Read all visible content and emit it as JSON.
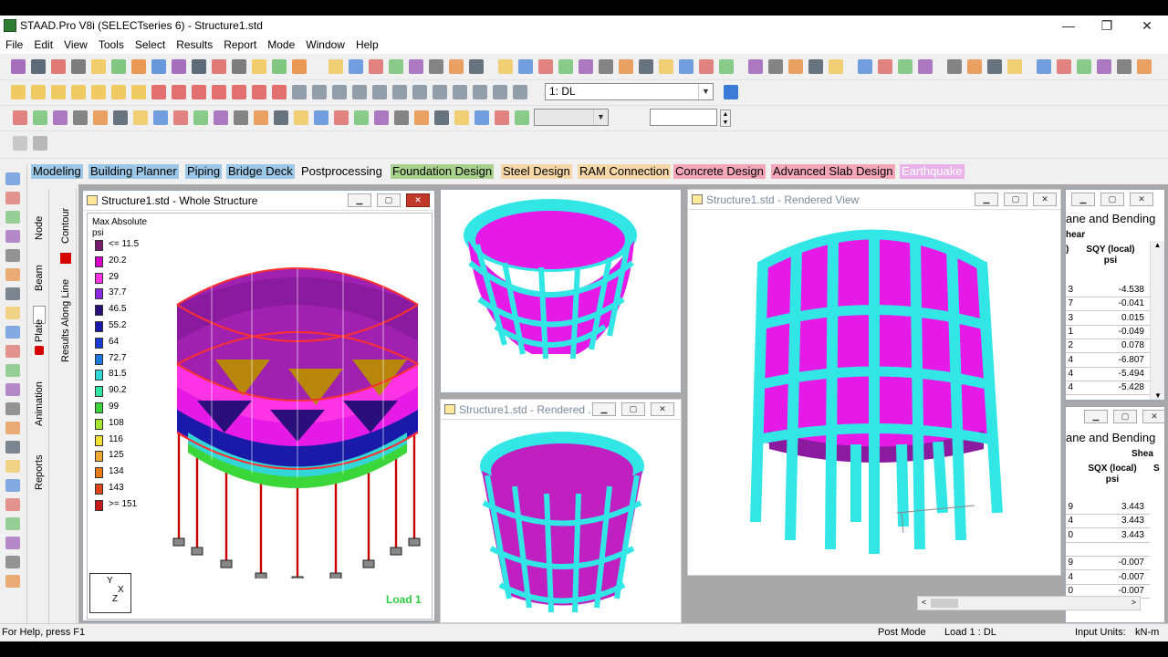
{
  "window": {
    "title": "STAAD.Pro V8i (SELECTseries 6) - Structure1.std",
    "minimize": "—",
    "restore": "❐",
    "close": "✕"
  },
  "menu": [
    "File",
    "Edit",
    "View",
    "Tools",
    "Select",
    "Results",
    "Report",
    "Mode",
    "Window",
    "Help"
  ],
  "toolbar": {
    "load_case_value": "1: DL",
    "combo2_value": "",
    "input_value": ""
  },
  "mode_tabs": [
    {
      "label": "Modeling",
      "bg": "#9cc7e6"
    },
    {
      "label": "Building Planner",
      "bg": "#9cc7e6"
    },
    {
      "label": "Piping",
      "bg": "#9cc7e6"
    },
    {
      "label": "Bridge Deck",
      "bg": "#9cc7e6"
    },
    {
      "label": "Postprocessing",
      "bg": "#f0f0f0"
    },
    {
      "label": "Foundation Design",
      "bg": "#a9d18e"
    },
    {
      "label": "Steel Design",
      "bg": "#f6d7a7"
    },
    {
      "label": "RAM Connection",
      "bg": "#f6d7a7"
    },
    {
      "label": "Concrete Design",
      "bg": "#f2a6b8"
    },
    {
      "label": "Advanced Slab Design",
      "bg": "#f2a6b8"
    },
    {
      "label": "Earthquake",
      "bg": "#e9b3ea"
    }
  ],
  "side_tabs": {
    "node": "Node",
    "beam": "Beam",
    "plate": "Plate",
    "animation": "Animation",
    "reports": "Reports",
    "contour": "Contour",
    "results_along_line": "Results Along Line"
  },
  "win_main": {
    "title": "Structure1.std - Whole Structure",
    "legend_title": "Max Absolute",
    "legend_unit": "psi",
    "legend": [
      {
        "label": "<= 11.5",
        "color": "#7a1a6e"
      },
      {
        "label": "20.2",
        "color": "#d400c8"
      },
      {
        "label": "29",
        "color": "#ff33e6"
      },
      {
        "label": "37.7",
        "color": "#8a2be2"
      },
      {
        "label": "46.5",
        "color": "#2a0f7a"
      },
      {
        "label": "55.2",
        "color": "#1a1aa8"
      },
      {
        "label": "64",
        "color": "#1a3ad6"
      },
      {
        "label": "72.7",
        "color": "#1f7ae0"
      },
      {
        "label": "81.5",
        "color": "#33d6d6"
      },
      {
        "label": "90.2",
        "color": "#33e6a6"
      },
      {
        "label": "99",
        "color": "#3ad63a"
      },
      {
        "label": "108",
        "color": "#a6e633"
      },
      {
        "label": "116",
        "color": "#f0e033"
      },
      {
        "label": "125",
        "color": "#f0a833"
      },
      {
        "label": "134",
        "color": "#e87a1a"
      },
      {
        "label": "143",
        "color": "#e0441a"
      },
      {
        "label": ">= 151",
        "color": "#c81a1a"
      }
    ],
    "load_label": "Load 1",
    "axis_y": "Y",
    "axis_x": "X",
    "axis_z": "Z"
  },
  "win_render_small": {
    "title": "Structure1.std - Rendered ..."
  },
  "win_render_large": {
    "title": "Structure1.std - Rendered View"
  },
  "table_top": {
    "header": "ane and Bending",
    "group": "hear",
    "col_left": ")",
    "col_head_1": "SQY (local)",
    "col_head_2": "psi",
    "rows": [
      {
        "k": "3",
        "v": "-4.538"
      },
      {
        "k": "7",
        "v": "-0.041"
      },
      {
        "k": "3",
        "v": "0.015"
      },
      {
        "k": "1",
        "v": "-0.049"
      },
      {
        "k": "2",
        "v": "0.078"
      },
      {
        "k": "4",
        "v": "-6.807"
      },
      {
        "k": "4",
        "v": "-5.494"
      },
      {
        "k": "4",
        "v": "-5.428"
      }
    ]
  },
  "table_bottom": {
    "header": "ane and Bending",
    "group": "Shea",
    "col_head_1": "SQX (local)",
    "col_head_2": "psi",
    "col_right": "S",
    "rows": [
      {
        "k": "9",
        "v": "3.443"
      },
      {
        "k": "4",
        "v": "3.443"
      },
      {
        "k": "0",
        "v": "3.443"
      },
      {
        "k": "",
        "v": ""
      },
      {
        "k": "9",
        "v": "-0.007"
      },
      {
        "k": "4",
        "v": "-0.007"
      },
      {
        "k": "0",
        "v": "-0.007"
      }
    ]
  },
  "status": {
    "help": "For Help, press F1",
    "mode": "Post Mode",
    "load": "Load 1 : DL",
    "units_label": "Input Units:",
    "units_value": "kN-m"
  },
  "colors": {
    "cyan": "#33e6e6",
    "magenta": "#e61ae6",
    "purple": "#8a1a9e",
    "red": "#d40000"
  }
}
